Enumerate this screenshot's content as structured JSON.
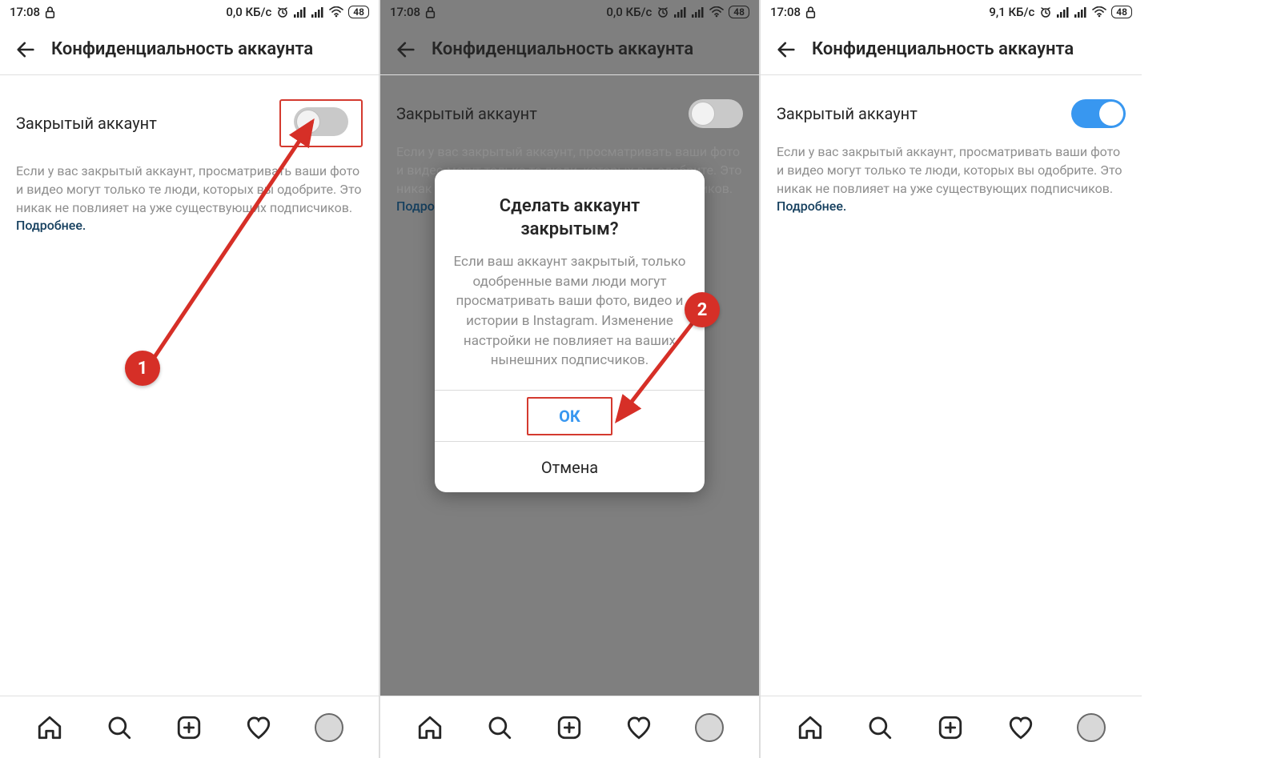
{
  "status": {
    "time": "17:08",
    "speed_a": "0,0 КБ/с",
    "speed_b": "0,0 КБ/с",
    "speed_c": "9,1 КБ/с",
    "battery": "48"
  },
  "header": {
    "title": "Конфиденциальность аккаунта"
  },
  "privacy": {
    "toggle_label": "Закрытый аккаунт",
    "description": "Если у вас закрытый аккаунт, просматривать ваши фото и видео могут только те люди, которых вы одобрите. Это никак не повлияет на уже существующих подписчиков. ",
    "learn_more": "Подробнее."
  },
  "dialog": {
    "title": "Сделать аккаунт закрытым?",
    "text": "Если ваш аккаунт закрытый, только одобренные вами люди могут просматривать ваши фото, видео и истории в Instagram. Изменение настройки не повлияет на ваших нынешних подписчиков.",
    "ok": "ОК",
    "cancel": "Отмена"
  },
  "annotation": {
    "step1": "1",
    "step2": "2"
  }
}
